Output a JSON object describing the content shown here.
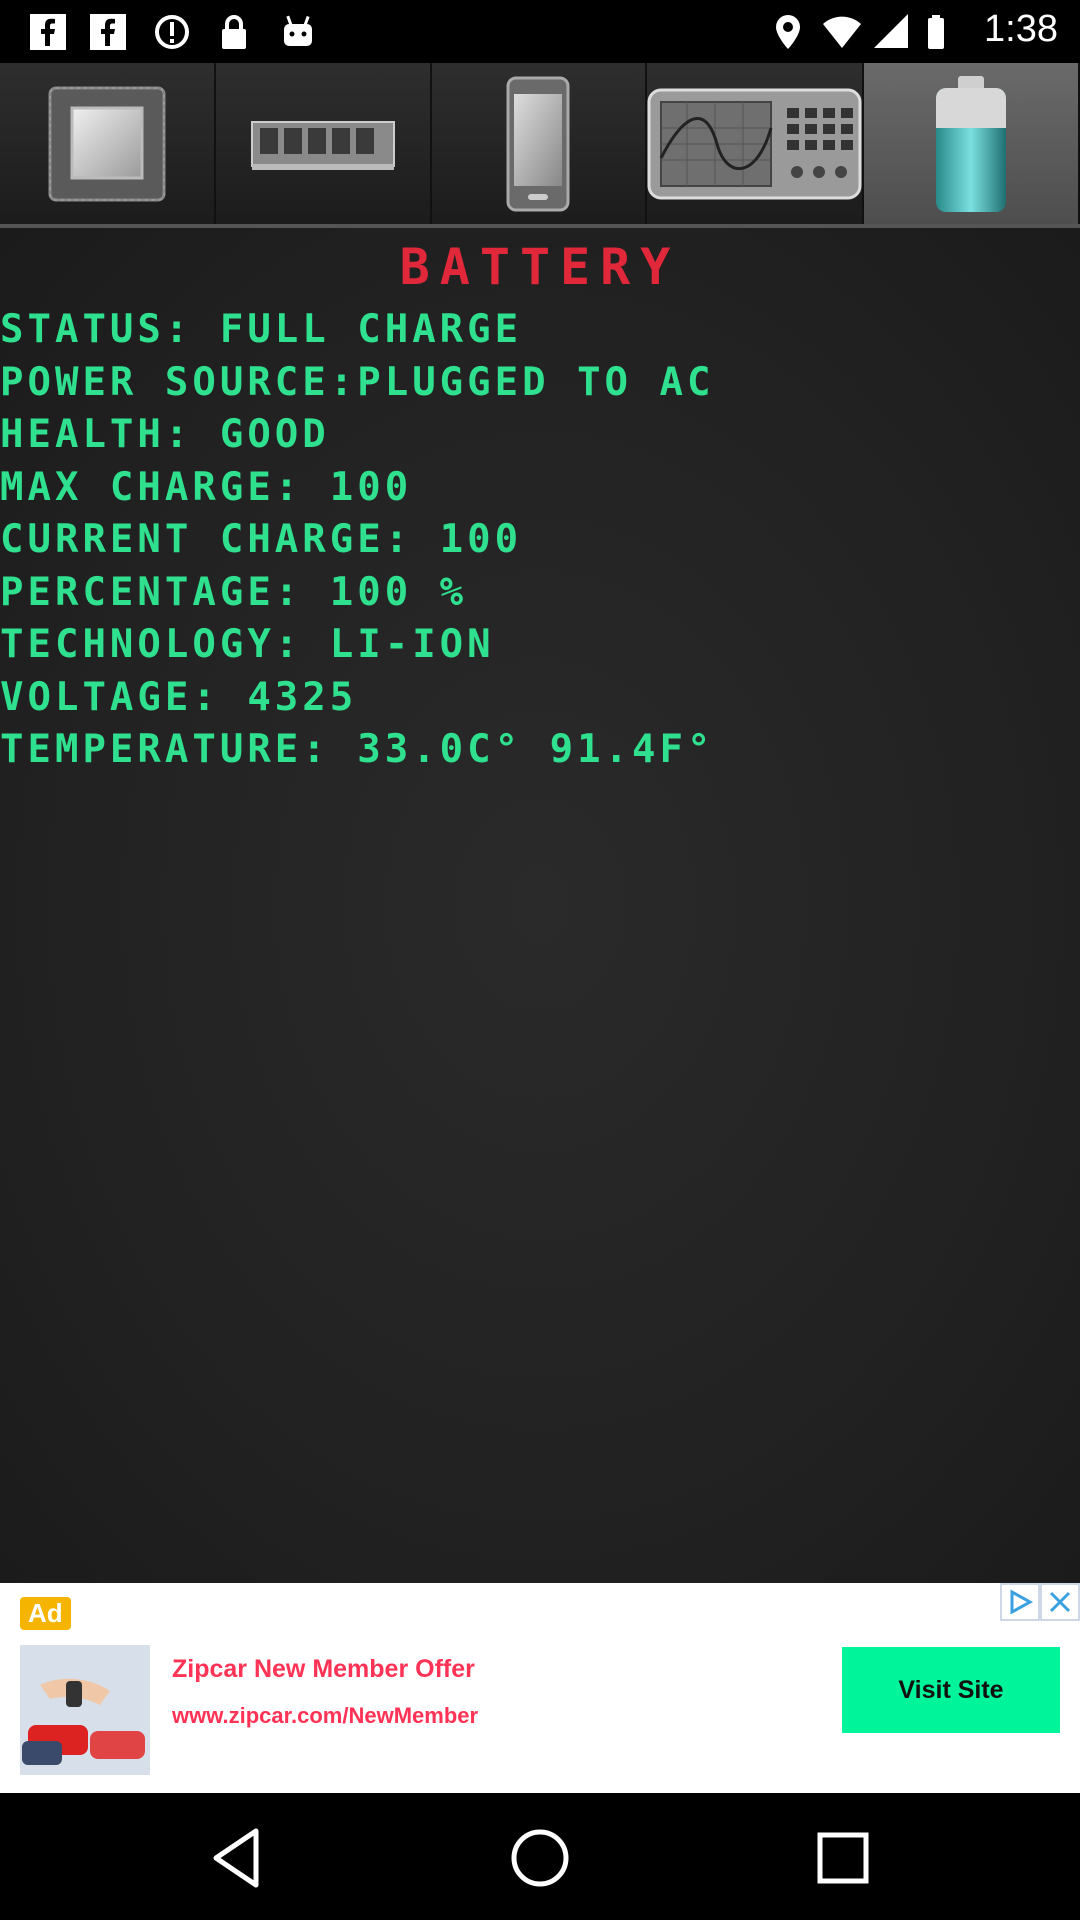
{
  "status_bar": {
    "time": "1:38",
    "icons": [
      "facebook-icon",
      "facebook-icon",
      "data-saver-icon",
      "lock-icon",
      "android-icon",
      "location-icon",
      "wifi-icon",
      "signal-icon",
      "battery-icon"
    ]
  },
  "tabs": [
    {
      "icon": "cpu-icon",
      "active": false
    },
    {
      "icon": "memory-icon",
      "active": false
    },
    {
      "icon": "phone-icon",
      "active": false
    },
    {
      "icon": "oscilloscope-icon",
      "active": false
    },
    {
      "icon": "battery-icon",
      "active": true
    }
  ],
  "main": {
    "title": "BATTERY",
    "lines": [
      "STATUS: FULL CHARGE",
      "POWER SOURCE:PLUGGED TO AC",
      "HEALTH: GOOD",
      "MAX CHARGE: 100",
      "CURRENT CHARGE: 100",
      "PERCENTAGE: 100 %",
      "TECHNOLOGY: LI-ION",
      "VOLTAGE: 4325",
      "TEMPERATURE: 33.0C° 91.4F°"
    ]
  },
  "ad": {
    "badge": "Ad",
    "title": "Zipcar New Member Offer",
    "url": "www.zipcar.com/NewMember",
    "button": "Visit Site"
  },
  "colors": {
    "title": "#e0283a",
    "info_text": "#2fe08f",
    "ad_text": "#ff3355",
    "ad_button": "#00f59b"
  }
}
